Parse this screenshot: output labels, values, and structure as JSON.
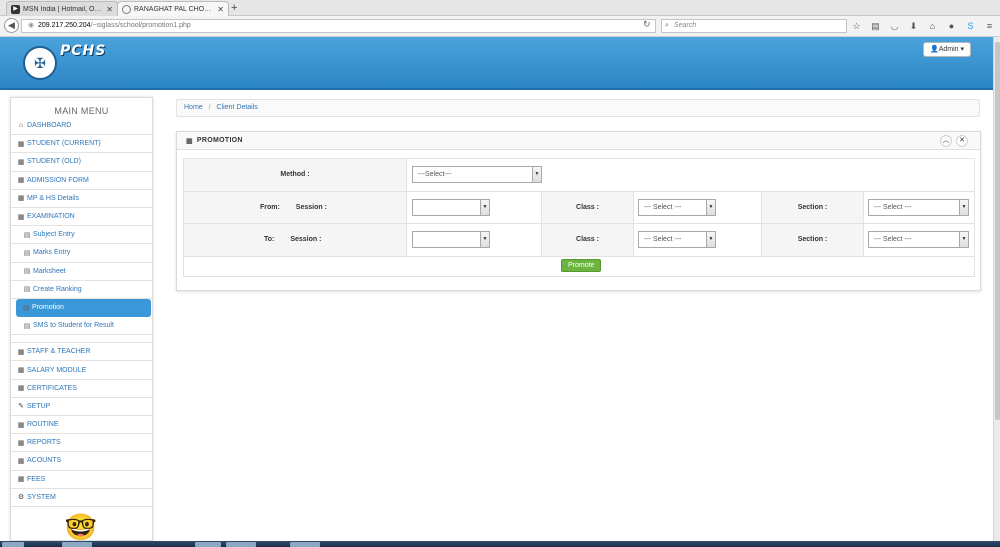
{
  "browser": {
    "tabs": [
      {
        "title": "MSN India | Hotmail, Outlo...",
        "active": false
      },
      {
        "title": "RANAGHAT PAL CHOWD...",
        "active": true
      }
    ],
    "url_host": "209.217.250.204",
    "url_path": "/~siglass/school/promotion1.php",
    "search_placeholder": "Search"
  },
  "header": {
    "brand": "PCHS",
    "admin_label": "Admin",
    "accent_color": "#3a97d8"
  },
  "sidebar": {
    "title": "MAIN MENU",
    "items": [
      {
        "label": "DASHBOARD",
        "icon": "home-icon"
      },
      {
        "label": "STUDENT (CURRENT)",
        "icon": "grid-icon"
      },
      {
        "label": "STUDENT (OLD)",
        "icon": "grid-icon"
      },
      {
        "label": "ADMISSION FORM",
        "icon": "grid-icon"
      },
      {
        "label": "MP & HS Details",
        "icon": "grid-icon"
      },
      {
        "label": "EXAMINATION",
        "icon": "grid-icon"
      }
    ],
    "subitems": [
      {
        "label": "Subject Entry",
        "icon": "list-icon"
      },
      {
        "label": "Marks Entry",
        "icon": "list-icon"
      },
      {
        "label": "Marksheet",
        "icon": "list-icon"
      },
      {
        "label": "Create Ranking",
        "icon": "list-icon"
      },
      {
        "label": "Promotion",
        "icon": "list-icon",
        "active": true
      },
      {
        "label": "SMS to Student for Result",
        "icon": "list-icon"
      }
    ],
    "items2": [
      {
        "label": "STAFF & TEACHER",
        "icon": "grid-icon"
      },
      {
        "label": "SALARY MODULE",
        "icon": "grid-icon"
      },
      {
        "label": "CERTIFICATES",
        "icon": "grid-icon"
      },
      {
        "label": "SETUP",
        "icon": "wrench-icon"
      },
      {
        "label": "ROUTINE",
        "icon": "grid-icon"
      },
      {
        "label": "REPORTS",
        "icon": "grid-icon"
      },
      {
        "label": "ACOUNTS",
        "icon": "grid-icon"
      },
      {
        "label": "FEES",
        "icon": "grid-icon"
      },
      {
        "label": "SYSTEM",
        "icon": "cogs-icon"
      }
    ]
  },
  "breadcrumb": {
    "home": "Home",
    "separator": "/",
    "current": "Client Details"
  },
  "panel": {
    "title": "PROMOTION",
    "form": {
      "method_label": "Method :",
      "method_value": "---Select---",
      "from_label": "From:",
      "to_label": "To:",
      "session_label": "Session :",
      "from_session_value": "",
      "to_session_value": "",
      "class_label": "Class :",
      "class_value": "--- Select ---",
      "section_label": "Section :",
      "section_value": "--- Select ---"
    },
    "promote_label": "Promote"
  }
}
